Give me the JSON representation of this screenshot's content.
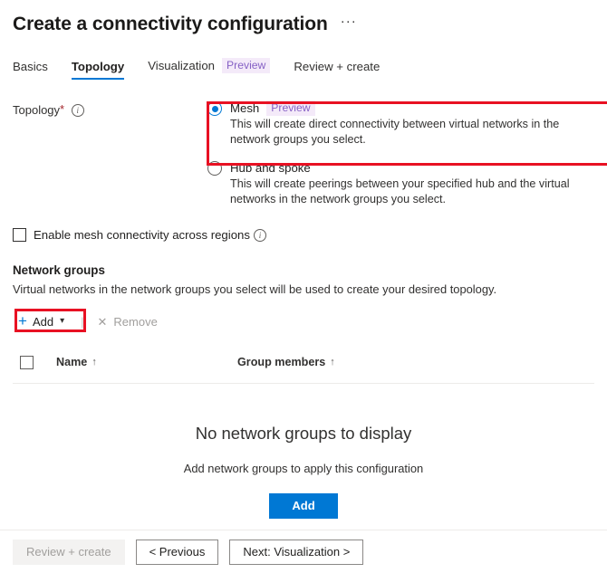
{
  "header": {
    "title": "Create a connectivity configuration",
    "more_menu": "···"
  },
  "tabs": [
    {
      "label": "Basics",
      "active": false,
      "badge": ""
    },
    {
      "label": "Topology",
      "active": true,
      "badge": ""
    },
    {
      "label": "Visualization",
      "active": false,
      "badge": "Preview"
    },
    {
      "label": "Review + create",
      "active": false,
      "badge": ""
    }
  ],
  "topology_field": {
    "label": "Topology",
    "required_marker": "*",
    "info_glyph": "i",
    "options": [
      {
        "title": "Mesh",
        "badge": "Preview",
        "description": "This will create direct connectivity between virtual networks in the network groups you select.",
        "selected": true
      },
      {
        "title": "Hub and spoke",
        "badge": "",
        "description": "This will create peerings between your specified hub and the virtual networks in the network groups you select.",
        "selected": false
      }
    ]
  },
  "cross_region": {
    "label": "Enable mesh connectivity across regions",
    "checked": false,
    "info_glyph": "i"
  },
  "network_groups": {
    "section_title": "Network groups",
    "section_description": "Virtual networks in the network groups you select will be used to create your desired topology.",
    "toolbar": {
      "add_label": "Add",
      "add_icon": "plus-icon",
      "add_chevron": "⌄",
      "separator": "|",
      "remove_label": "Remove",
      "remove_icon": "✕"
    },
    "columns": [
      {
        "label": "Name",
        "sort": "↑"
      },
      {
        "label": "Group members",
        "sort": "↑"
      }
    ],
    "rows": [],
    "empty_state": {
      "title": "No network groups to display",
      "subtitle": "Add network groups to apply this configuration",
      "button_label": "Add"
    }
  },
  "footer": {
    "review_create_label": "Review + create",
    "previous_label": "< Previous",
    "next_label": "Next: Visualization >"
  },
  "colors": {
    "accent": "#0078d4",
    "highlight": "#e81123",
    "preview_badge_bg": "#f4eaf9",
    "preview_badge_fg": "#8661c5",
    "required_star": "#a4262c"
  }
}
